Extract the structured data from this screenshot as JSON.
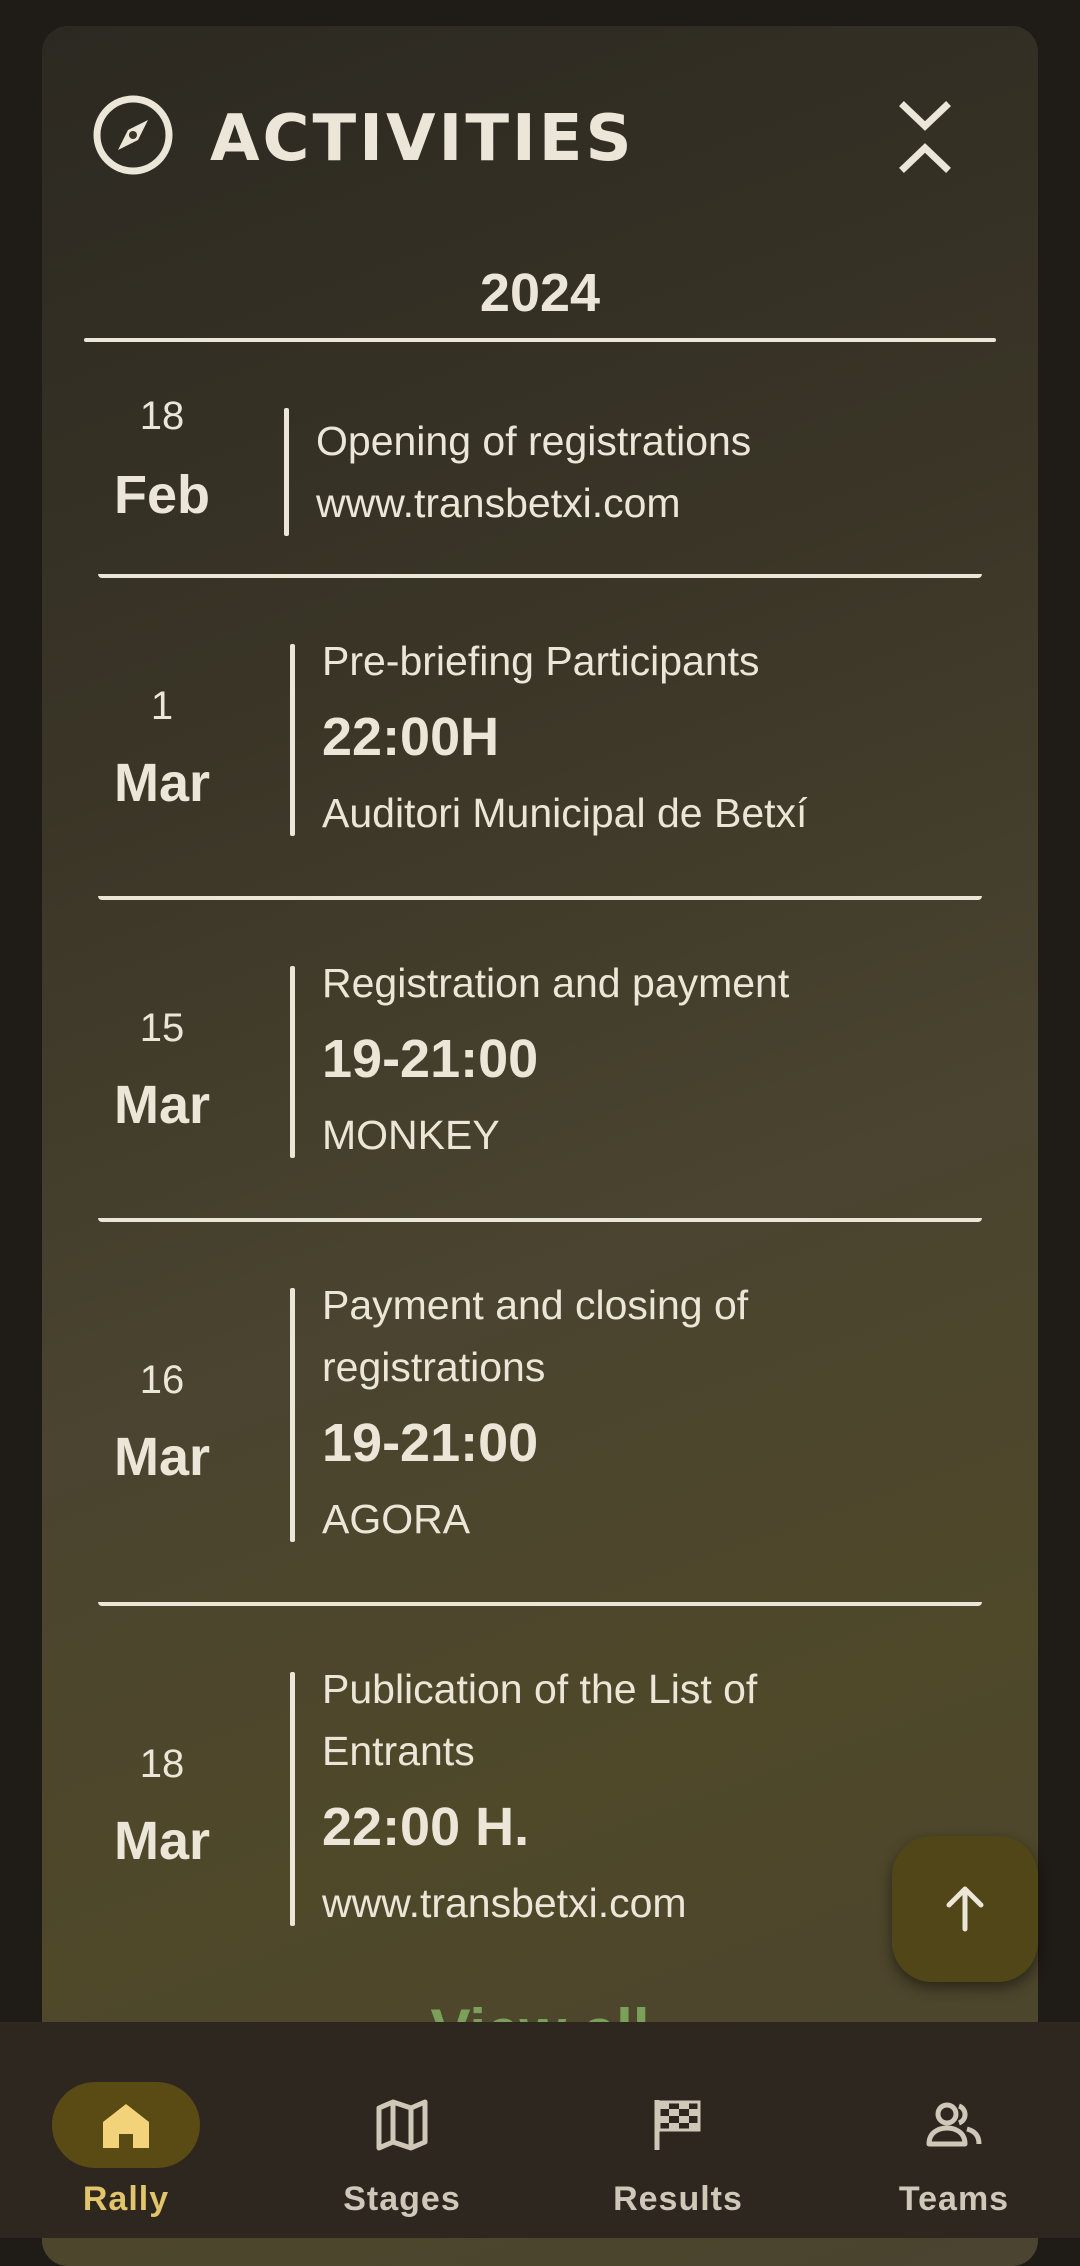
{
  "header": {
    "title": "ACTIVITIES",
    "compass_icon": "compass-icon",
    "collapse_icon": "collapse-icon"
  },
  "year": "2024",
  "events": [
    {
      "day": "18",
      "month": "Feb",
      "title": "Opening of registrations",
      "line2": "www.transbetxi.com"
    },
    {
      "day": "1",
      "month": "Mar",
      "title": "Pre-briefing Participants",
      "time": "22:00H",
      "place": "Auditori Municipal de Betxí"
    },
    {
      "day": "15",
      "month": "Mar",
      "title": "Registration and payment",
      "time": "19-21:00",
      "place": "MONKEY"
    },
    {
      "day": "16",
      "month": "Mar",
      "title_line1": "Payment and closing of",
      "title_line2": "registrations",
      "time": "19-21:00",
      "place": "AGORA"
    },
    {
      "day": "18",
      "month": "Mar",
      "title_line1": "Publication of the List of",
      "title_line2": "Entrants",
      "time": "22:00 H.",
      "place": "www.transbetxi.com"
    }
  ],
  "view_all": "View all",
  "nav": {
    "items": [
      {
        "label": "Rally",
        "icon": "home-icon",
        "active": true
      },
      {
        "label": "Stages",
        "icon": "map-icon",
        "active": false
      },
      {
        "label": "Results",
        "icon": "checkered-flag-icon",
        "active": false
      },
      {
        "label": "Teams",
        "icon": "people-icon",
        "active": false
      }
    ]
  },
  "colors": {
    "accent": "#e2c46a",
    "fab": "#514617",
    "navbar": "#2d2720",
    "text": "#ece6d8"
  }
}
